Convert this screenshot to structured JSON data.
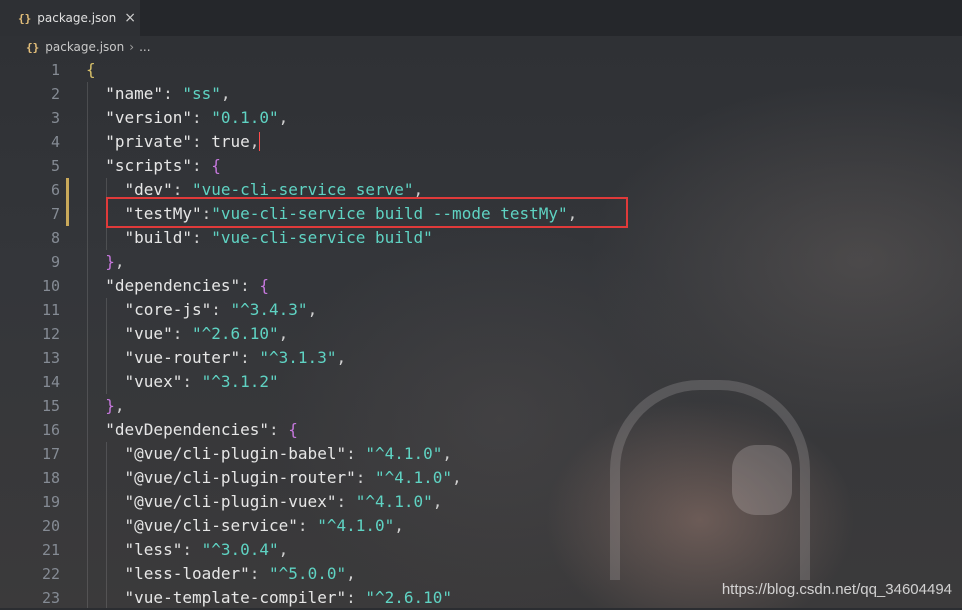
{
  "tab": {
    "icon": "{}",
    "filename": "package.json",
    "close": "×"
  },
  "breadcrumb": {
    "icon": "{}",
    "file": "package.json",
    "sep": "›",
    "more": "..."
  },
  "lines": [
    {
      "n": "1",
      "parts": [
        [
          "brace",
          "{"
        ]
      ]
    },
    {
      "n": "2",
      "parts": [
        [
          "sp",
          "  "
        ],
        [
          "key",
          "\"name\""
        ],
        [
          "punc",
          ": "
        ],
        [
          "str",
          "\"ss\""
        ],
        [
          "punc",
          ","
        ]
      ]
    },
    {
      "n": "3",
      "parts": [
        [
          "sp",
          "  "
        ],
        [
          "key",
          "\"version\""
        ],
        [
          "punc",
          ": "
        ],
        [
          "str",
          "\"0.1.0\""
        ],
        [
          "punc",
          ","
        ]
      ]
    },
    {
      "n": "4",
      "parts": [
        [
          "sp",
          "  "
        ],
        [
          "key",
          "\"private\""
        ],
        [
          "punc",
          ": "
        ],
        [
          "bool",
          "true"
        ],
        [
          "punc",
          ","
        ]
      ],
      "cursor": true
    },
    {
      "n": "5",
      "parts": [
        [
          "sp",
          "  "
        ],
        [
          "key",
          "\"scripts\""
        ],
        [
          "punc",
          ": "
        ],
        [
          "brace2",
          "{"
        ]
      ]
    },
    {
      "n": "6",
      "parts": [
        [
          "sp",
          "    "
        ],
        [
          "key",
          "\"dev\""
        ],
        [
          "punc",
          ": "
        ],
        [
          "str",
          "\"vue-cli-service serve\""
        ],
        [
          "punc",
          ","
        ]
      ],
      "mark": true
    },
    {
      "n": "7",
      "parts": [
        [
          "sp",
          "    "
        ],
        [
          "key",
          "\"testMy\""
        ],
        [
          "punc",
          ":"
        ],
        [
          "str",
          "\"vue-cli-service build --mode testMy\""
        ],
        [
          "punc",
          ","
        ]
      ],
      "mark": true
    },
    {
      "n": "8",
      "parts": [
        [
          "sp",
          "    "
        ],
        [
          "key",
          "\"build\""
        ],
        [
          "punc",
          ": "
        ],
        [
          "str",
          "\"vue-cli-service build\""
        ]
      ]
    },
    {
      "n": "9",
      "parts": [
        [
          "sp",
          "  "
        ],
        [
          "brace2",
          "}"
        ],
        [
          "punc",
          ","
        ]
      ]
    },
    {
      "n": "10",
      "parts": [
        [
          "sp",
          "  "
        ],
        [
          "key",
          "\"dependencies\""
        ],
        [
          "punc",
          ": "
        ],
        [
          "brace2",
          "{"
        ]
      ]
    },
    {
      "n": "11",
      "parts": [
        [
          "sp",
          "    "
        ],
        [
          "key",
          "\"core-js\""
        ],
        [
          "punc",
          ": "
        ],
        [
          "str",
          "\"^3.4.3\""
        ],
        [
          "punc",
          ","
        ]
      ]
    },
    {
      "n": "12",
      "parts": [
        [
          "sp",
          "    "
        ],
        [
          "key",
          "\"vue\""
        ],
        [
          "punc",
          ": "
        ],
        [
          "str",
          "\"^2.6.10\""
        ],
        [
          "punc",
          ","
        ]
      ]
    },
    {
      "n": "13",
      "parts": [
        [
          "sp",
          "    "
        ],
        [
          "key",
          "\"vue-router\""
        ],
        [
          "punc",
          ": "
        ],
        [
          "str",
          "\"^3.1.3\""
        ],
        [
          "punc",
          ","
        ]
      ]
    },
    {
      "n": "14",
      "parts": [
        [
          "sp",
          "    "
        ],
        [
          "key",
          "\"vuex\""
        ],
        [
          "punc",
          ": "
        ],
        [
          "str",
          "\"^3.1.2\""
        ]
      ]
    },
    {
      "n": "15",
      "parts": [
        [
          "sp",
          "  "
        ],
        [
          "brace2",
          "}"
        ],
        [
          "punc",
          ","
        ]
      ]
    },
    {
      "n": "16",
      "parts": [
        [
          "sp",
          "  "
        ],
        [
          "key",
          "\"devDependencies\""
        ],
        [
          "punc",
          ": "
        ],
        [
          "brace2",
          "{"
        ]
      ]
    },
    {
      "n": "17",
      "parts": [
        [
          "sp",
          "    "
        ],
        [
          "key",
          "\"@vue/cli-plugin-babel\""
        ],
        [
          "punc",
          ": "
        ],
        [
          "str",
          "\"^4.1.0\""
        ],
        [
          "punc",
          ","
        ]
      ]
    },
    {
      "n": "18",
      "parts": [
        [
          "sp",
          "    "
        ],
        [
          "key",
          "\"@vue/cli-plugin-router\""
        ],
        [
          "punc",
          ": "
        ],
        [
          "str",
          "\"^4.1.0\""
        ],
        [
          "punc",
          ","
        ]
      ]
    },
    {
      "n": "19",
      "parts": [
        [
          "sp",
          "    "
        ],
        [
          "key",
          "\"@vue/cli-plugin-vuex\""
        ],
        [
          "punc",
          ": "
        ],
        [
          "str",
          "\"^4.1.0\""
        ],
        [
          "punc",
          ","
        ]
      ]
    },
    {
      "n": "20",
      "parts": [
        [
          "sp",
          "    "
        ],
        [
          "key",
          "\"@vue/cli-service\""
        ],
        [
          "punc",
          ": "
        ],
        [
          "str",
          "\"^4.1.0\""
        ],
        [
          "punc",
          ","
        ]
      ]
    },
    {
      "n": "21",
      "parts": [
        [
          "sp",
          "    "
        ],
        [
          "key",
          "\"less\""
        ],
        [
          "punc",
          ": "
        ],
        [
          "str",
          "\"^3.0.4\""
        ],
        [
          "punc",
          ","
        ]
      ]
    },
    {
      "n": "22",
      "parts": [
        [
          "sp",
          "    "
        ],
        [
          "key",
          "\"less-loader\""
        ],
        [
          "punc",
          ": "
        ],
        [
          "str",
          "\"^5.0.0\""
        ],
        [
          "punc",
          ","
        ]
      ]
    },
    {
      "n": "23",
      "parts": [
        [
          "sp",
          "    "
        ],
        [
          "key",
          "\"vue-template-compiler\""
        ],
        [
          "punc",
          ": "
        ],
        [
          "str",
          "\"^2.6.10\""
        ]
      ]
    }
  ],
  "watermark": "https://blog.csdn.net/qq_34604494",
  "colors": {
    "string": "#5fd3c3",
    "highlight_box": "#e03a3a",
    "modified_marker": "#c9a95a"
  }
}
